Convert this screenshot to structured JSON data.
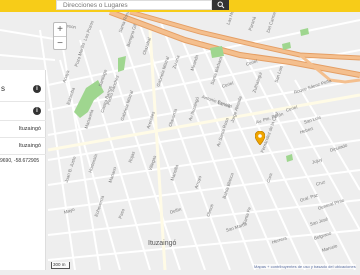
{
  "search": {
    "placeholder": "Direcciones o Lugares"
  },
  "zoom": {
    "in_label": "+",
    "out_label": "−"
  },
  "panel": {
    "heading": "s",
    "place1": "Ituzaingó",
    "place2": "Ituzaingó",
    "coords": "9690, -58.672905"
  },
  "map": {
    "city": "Ituzaingó",
    "scale": "300 m",
    "attribution": "Mapas + contribuyentes de uso y basado del ubicaciones",
    "streets": [
      "Rawson",
      "Los Pozos",
      "Santa Rosa",
      "Benigno Gil",
      "Olazabal",
      "Las Heras",
      "Paraná",
      "Del Carmen",
      "Pedro Sánchez",
      "Santiago",
      "Pozo Morillo",
      "Estomba",
      "Anaya",
      "Marianela",
      "Castro Barros",
      "Gabriela Mistral",
      "Gabriela Mistral",
      "Zuviría",
      "Miranda",
      "Santa Bárbara",
      "Arenales",
      "Olavarría",
      "Antonio Beneito",
      "Larrea",
      "Av Ituzaingó",
      "Ceriel",
      "Ceriel",
      "Ceriel",
      "Av Santa Rosa",
      "Jorge Almada",
      "Zufriategui",
      "San Luis",
      "Hebert",
      "Jujuy",
      "Juan B. Justo",
      "Hortensia",
      "Mariano",
      "Rojas",
      "Villegas",
      "Mansilla",
      "Arroyo",
      "Bahía Blanca",
      "Mayo",
      "Echeverría",
      "Paso",
      "Delfín",
      "Olmos",
      "Santa Fe",
      "Fernández de la Cruz",
      "San Luis",
      "Cruz",
      "Gral. Paz",
      "General Pinto",
      "San José",
      "Belgrano",
      "Herrera",
      "San Martín",
      "Av. Pte. Perón",
      "Roque Sáenz Peña",
      "Diputado",
      "Marcelo",
      "Cura"
    ]
  },
  "colors": {
    "topbar": "#f7cc18",
    "pin": "#f0a500",
    "highway": "#f0b27a",
    "park": "#9fd68f"
  }
}
